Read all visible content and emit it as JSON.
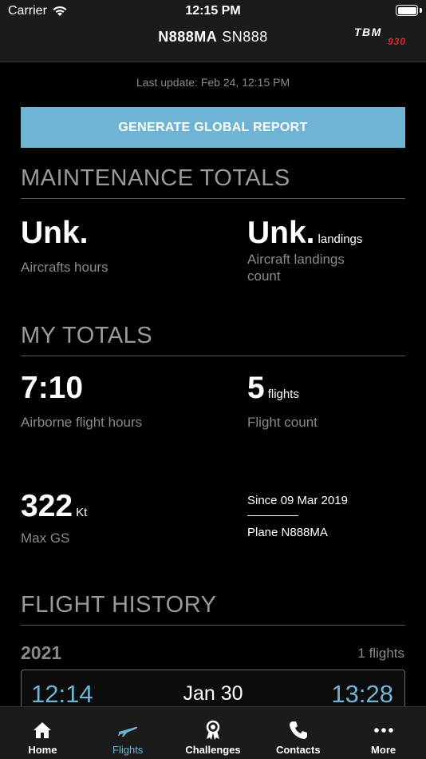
{
  "status_bar": {
    "carrier": "Carrier",
    "time": "12:15 PM"
  },
  "header": {
    "registration": "N888MA",
    "serial": "SN888",
    "logo_text": "TBM",
    "logo_sub": "930"
  },
  "last_update": "Last update: Feb 24, 12:15 PM",
  "report_button": "GENERATE GLOBAL REPORT",
  "maintenance": {
    "title": "MAINTENANCE TOTALS",
    "hours_value": "Unk.",
    "hours_caption": "Aircrafts hours",
    "landings_value": "Unk.",
    "landings_unit": "landings",
    "landings_caption_1": "Aircraft landings",
    "landings_caption_2": "count"
  },
  "my_totals": {
    "title": "MY TOTALS",
    "airborne_value": "7:10",
    "airborne_caption": "Airborne flight hours",
    "flights_value": "5",
    "flights_unit": "flights",
    "flights_caption": "Flight count",
    "max_gs_value": "322",
    "max_gs_unit": "Kt",
    "max_gs_caption": "Max GS",
    "since": "Since 09 Mar 2019",
    "plane": "Plane N888MA"
  },
  "history": {
    "title": "FLIGHT HISTORY",
    "year": "2021",
    "year_count": "1 flights",
    "flight": {
      "departure": "12:14",
      "date": "Jan 30",
      "arrival": "13:28"
    }
  },
  "tabs": [
    {
      "label": "Home",
      "icon": "home-icon"
    },
    {
      "label": "Flights",
      "icon": "plane-icon"
    },
    {
      "label": "Challenges",
      "icon": "medal-icon"
    },
    {
      "label": "Contacts",
      "icon": "phone-icon"
    },
    {
      "label": "More",
      "icon": "more-dots-icon"
    }
  ],
  "colors": {
    "accent": "#6fb4d3",
    "logo_red": "#d62a32",
    "background": "#000000"
  }
}
